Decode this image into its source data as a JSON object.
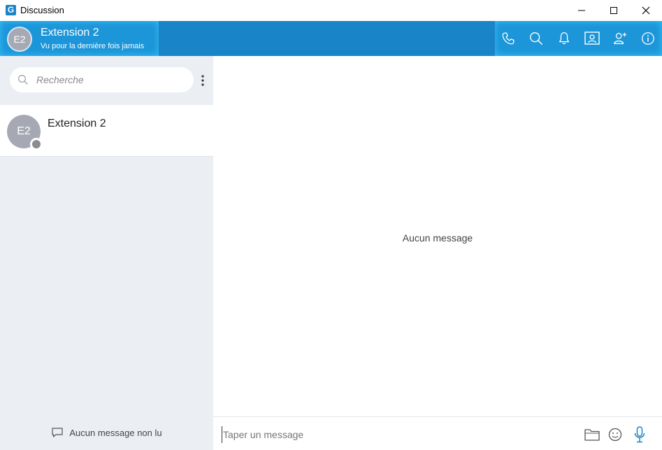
{
  "window": {
    "title": "Discussion",
    "logo_letter": "G",
    "controls": [
      "minimize-icon",
      "maximize-icon",
      "close-icon"
    ]
  },
  "header": {
    "avatar_initials": "E2",
    "contact_name": "Extension 2",
    "status": "Vu pour la dernière fois jamais",
    "actions": [
      "phone-icon",
      "search-icon",
      "bell-icon",
      "contact-card-icon",
      "add-user-icon",
      "info-icon"
    ]
  },
  "sidebar": {
    "search": {
      "placeholder": "Recherche"
    },
    "contacts": [
      {
        "initials": "E2",
        "name": "Extension 2",
        "presence": "offline"
      }
    ],
    "footer_label": "Aucun message non lu"
  },
  "conversation": {
    "empty_label": "Aucun message"
  },
  "composer": {
    "placeholder": "Taper un message",
    "actions": [
      "folder-icon",
      "emoji-icon",
      "microphone-icon"
    ]
  },
  "colors": {
    "brand_blue": "#1a84c9",
    "header_glow": "#1c96d8",
    "sidebar_bg": "#ebeef3",
    "avatar_gray": "#a6a9b4",
    "presence_offline": "#8c8c8c",
    "mic_blue": "#1a84c9"
  }
}
